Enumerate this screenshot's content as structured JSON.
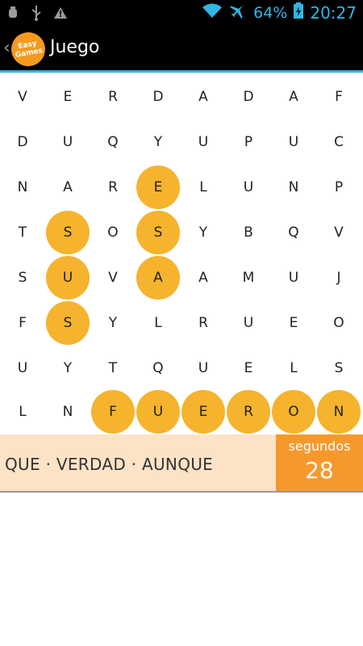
{
  "status_bar": {
    "battery": "64%",
    "time": "20:27",
    "icons": [
      "android-debug-icon",
      "usb-icon",
      "warning-icon",
      "wifi-icon",
      "airplane-icon",
      "battery-icon"
    ]
  },
  "action_bar": {
    "title": "Juego",
    "logo_text": [
      "Easy",
      "Games"
    ]
  },
  "grid": {
    "rows": [
      [
        "V",
        "E",
        "R",
        "D",
        "A",
        "D",
        "A",
        "F"
      ],
      [
        "D",
        "U",
        "Q",
        "Y",
        "U",
        "P",
        "U",
        "C"
      ],
      [
        "N",
        "A",
        "R",
        "E",
        "L",
        "U",
        "N",
        "P"
      ],
      [
        "T",
        "S",
        "O",
        "S",
        "Y",
        "B",
        "Q",
        "V"
      ],
      [
        "S",
        "U",
        "V",
        "A",
        "A",
        "M",
        "U",
        "J"
      ],
      [
        "F",
        "S",
        "Y",
        "L",
        "R",
        "U",
        "E",
        "O"
      ],
      [
        "U",
        "Y",
        "T",
        "Q",
        "U",
        "E",
        "L",
        "S"
      ],
      [
        "L",
        "N",
        "F",
        "U",
        "E",
        "R",
        "O",
        "N"
      ]
    ],
    "highlighted": [
      [
        2,
        3
      ],
      [
        3,
        1
      ],
      [
        3,
        3
      ],
      [
        4,
        1
      ],
      [
        4,
        3
      ],
      [
        5,
        1
      ],
      [
        7,
        2
      ],
      [
        7,
        3
      ],
      [
        7,
        4
      ],
      [
        7,
        5
      ],
      [
        7,
        6
      ],
      [
        7,
        7
      ]
    ],
    "highlight_color": "#f5b32e"
  },
  "panel": {
    "words": "QUE ·  VERDAD ·  AUNQUE",
    "timer_label": "segundos",
    "timer_value": "28",
    "timer_color": "#f5992d",
    "background_color": "#fde3c6"
  }
}
